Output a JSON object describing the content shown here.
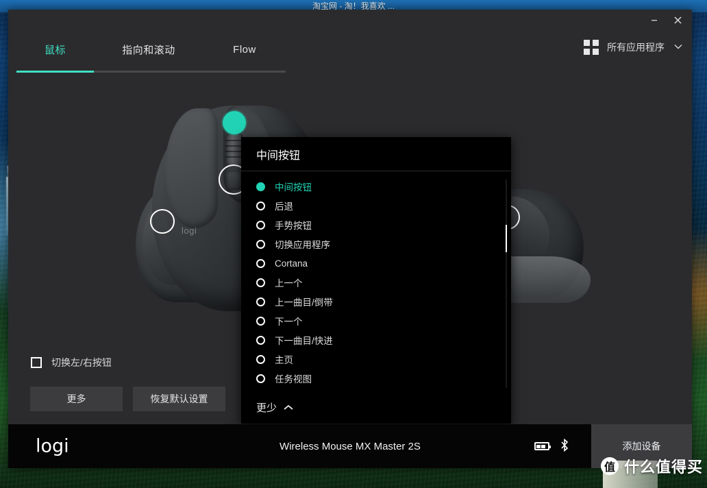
{
  "desktop": {
    "background_browser_title": "淘宝网 - 淘！我喜欢 ..."
  },
  "window": {
    "minimize_label": "−",
    "close_label": "✕",
    "tabs": [
      {
        "label": "鼠标",
        "active": true
      },
      {
        "label": "指向和滚动",
        "active": false
      },
      {
        "label": "Flow",
        "active": false
      }
    ],
    "toolbar": {
      "grid_icon": "grid-icon",
      "all_apps_label": "所有应用程序",
      "chevron": "⌄"
    },
    "accent_color": "#21d3b4"
  },
  "stage": {
    "mouse_logo": "logi",
    "checkbox": {
      "label": "切换左/右按钮",
      "checked": false
    },
    "buttons": [
      {
        "label": "更多"
      },
      {
        "label": "恢复默认设置"
      }
    ]
  },
  "popup": {
    "title": "中间按钮",
    "options": [
      {
        "label": "中间按钮",
        "selected": true
      },
      {
        "label": "后退",
        "selected": false
      },
      {
        "label": "手势按钮",
        "selected": false
      },
      {
        "label": "切换应用程序",
        "selected": false
      },
      {
        "label": "Cortana",
        "selected": false
      },
      {
        "label": "上一个",
        "selected": false
      },
      {
        "label": "上一曲目/倒带",
        "selected": false
      },
      {
        "label": "下一个",
        "selected": false
      },
      {
        "label": "下一曲目/快进",
        "selected": false
      },
      {
        "label": "主页",
        "selected": false
      },
      {
        "label": "任务视图",
        "selected": false
      }
    ],
    "footer_label": "更少",
    "footer_chevron": "chevron-up-icon"
  },
  "devicebar": {
    "brand": "logi",
    "device_name": "Wireless Mouse MX Master 2S",
    "battery_icon": "battery-icon",
    "bluetooth_icon": "bluetooth-icon",
    "add_device_label": "添加设备"
  },
  "watermark": {
    "badge": "值",
    "text": "什么值得买"
  }
}
